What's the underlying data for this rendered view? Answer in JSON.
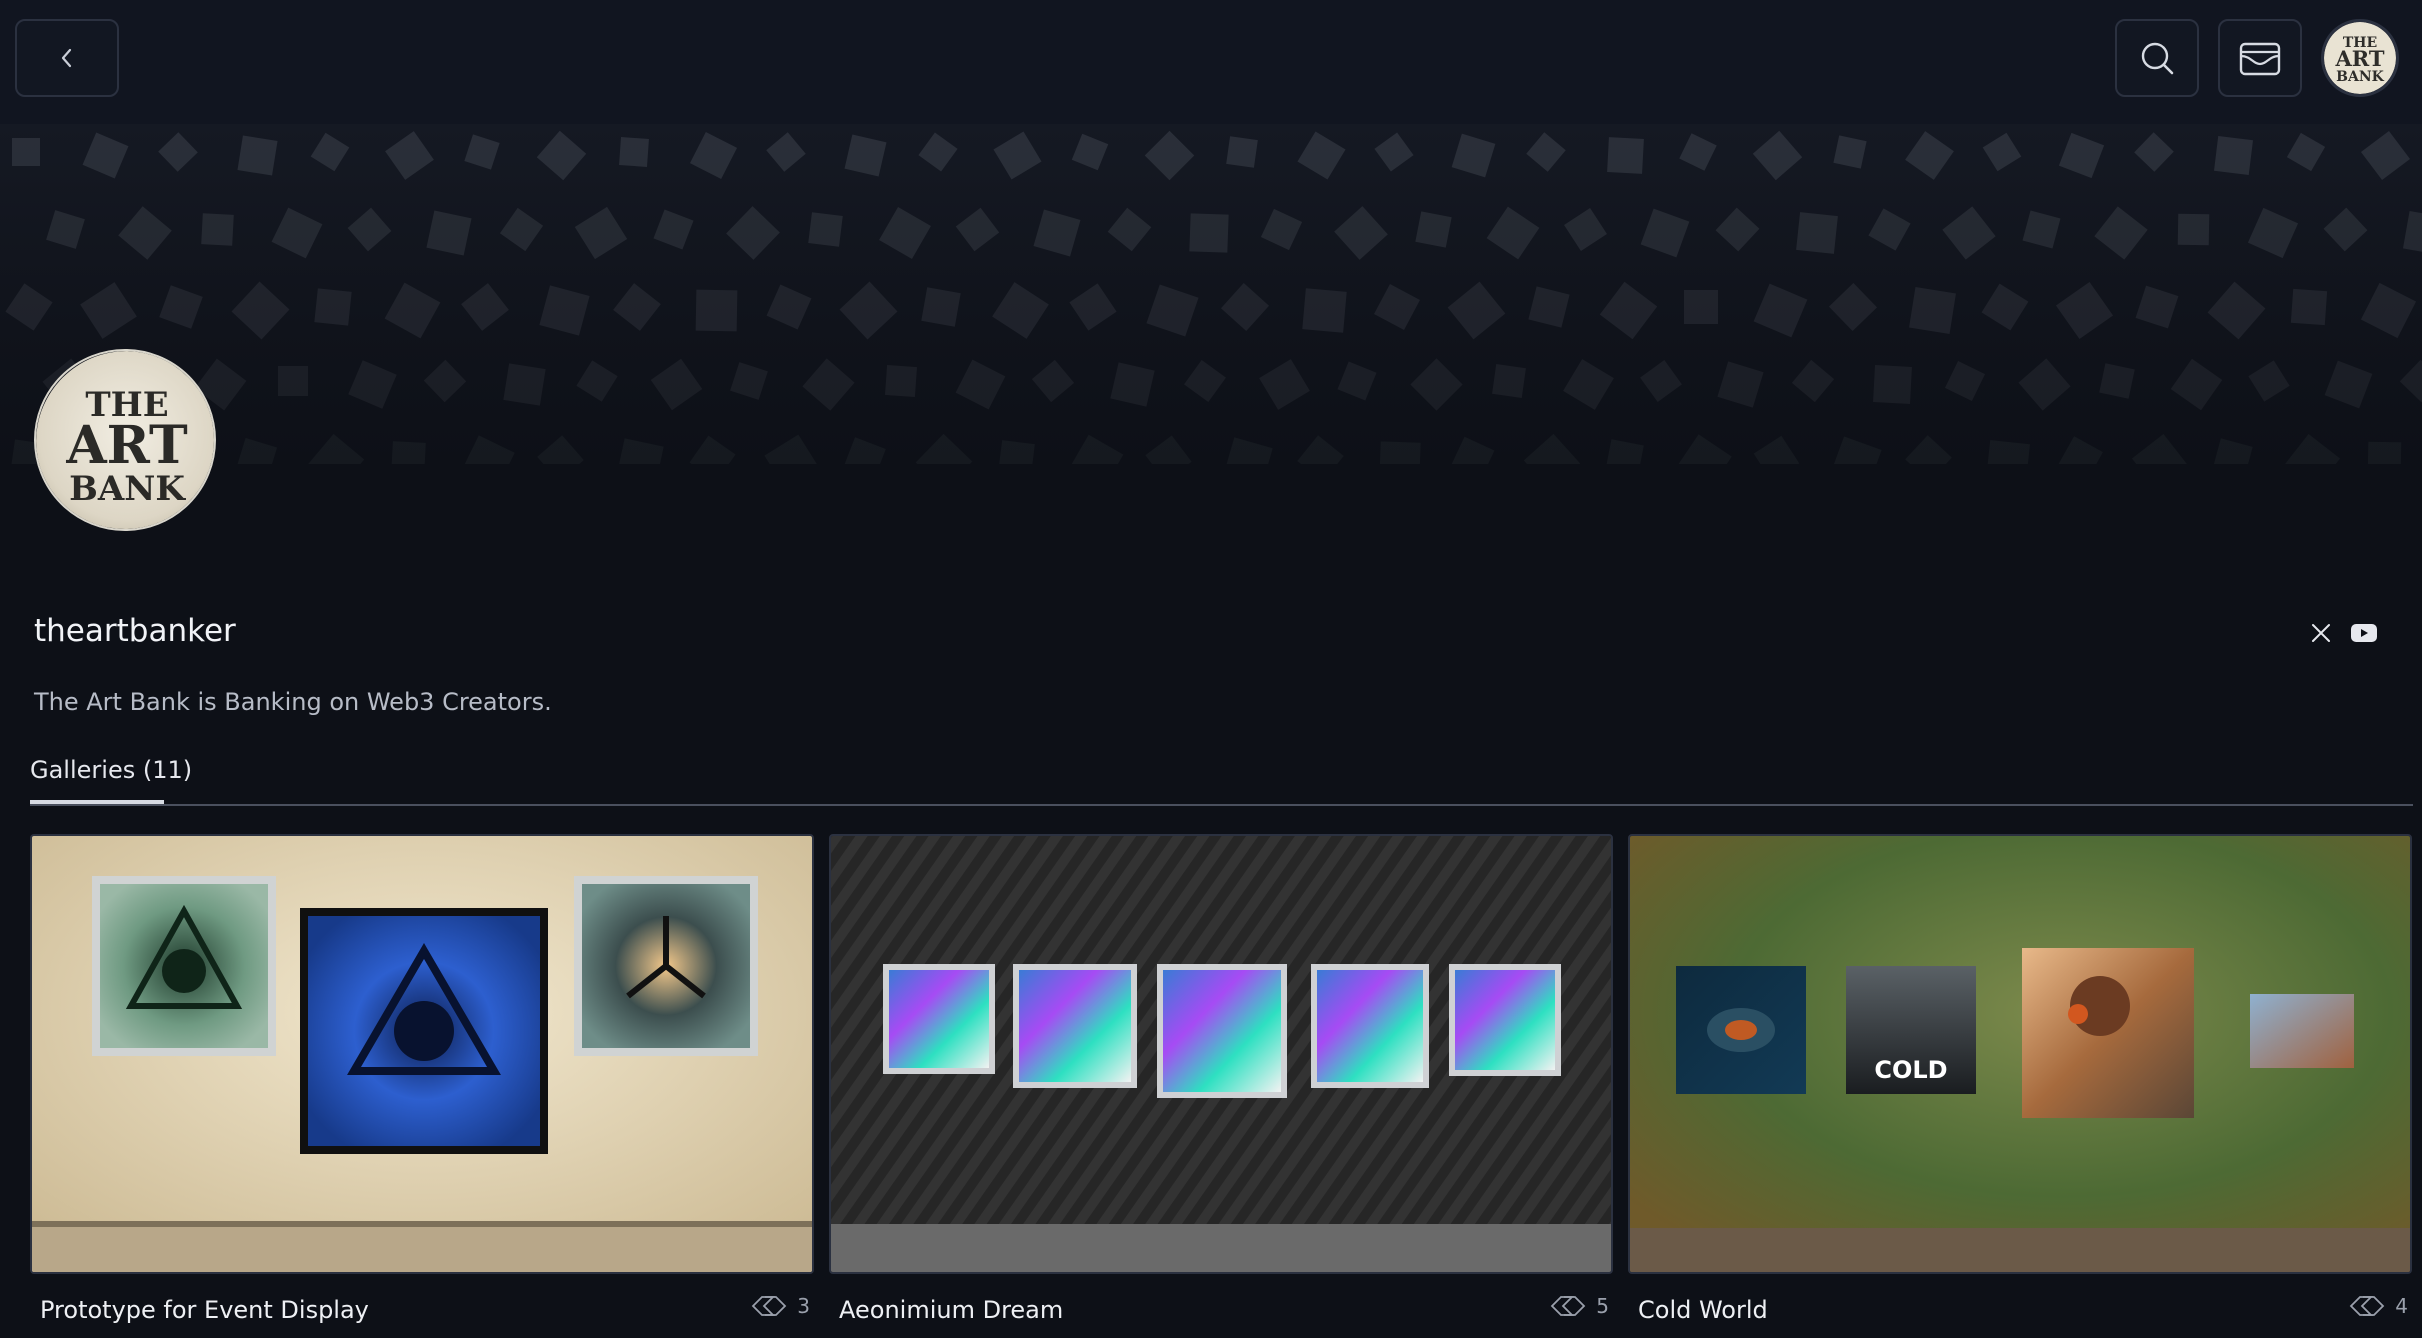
{
  "header": {
    "back_icon": "chevron-left-icon",
    "search_icon": "search-icon",
    "wallet_icon": "wallet-icon",
    "avatar_logo_text": [
      "THE",
      "ART",
      "BANK"
    ]
  },
  "profile": {
    "logo_text": [
      "THE",
      "ART",
      "BANK"
    ],
    "username": "theartbanker",
    "bio": "The Art Bank is Banking on Web3 Creators.",
    "social": {
      "x_icon": "x-logo-icon",
      "youtube_icon": "youtube-icon"
    }
  },
  "tabs": [
    {
      "label": "Galleries (11)",
      "active": true
    }
  ],
  "galleries": [
    {
      "title": "Prototype for Event Display",
      "count": "3",
      "count_icon": "layers-icon"
    },
    {
      "title": "Aeonimium Dream",
      "count": "5",
      "count_icon": "layers-icon"
    },
    {
      "title": "Cold World",
      "count": "4",
      "count_icon": "layers-icon"
    }
  ],
  "colors": {
    "background": "#0d1017",
    "topbar": "#111520",
    "border": "#2b3140",
    "text": "#e6e8ee",
    "muted": "#9aa0ac"
  }
}
